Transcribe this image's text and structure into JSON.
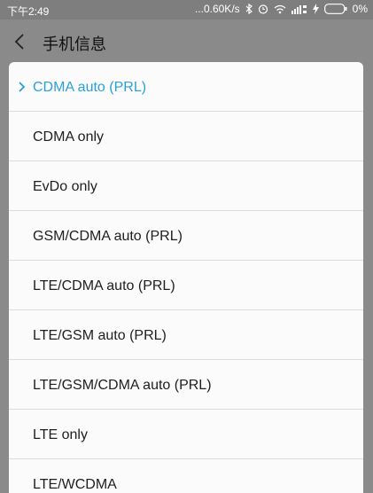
{
  "status_bar": {
    "time": "下午2:49",
    "network_speed": "...0.60K/s",
    "battery_percent": "0%",
    "icons": [
      "bluetooth-icon",
      "alarm-icon",
      "wifi-icon",
      "signal-icon",
      "charging-icon",
      "battery-icon"
    ]
  },
  "app_bar": {
    "title": "手机信息",
    "back_icon": "back-chevron-icon"
  },
  "network_options": {
    "selected": "CDMA auto (PRL)",
    "items": [
      {
        "label": "CDMA auto (PRL)"
      },
      {
        "label": "CDMA only"
      },
      {
        "label": "EvDo only"
      },
      {
        "label": "GSM/CDMA auto (PRL)"
      },
      {
        "label": "LTE/CDMA auto (PRL)"
      },
      {
        "label": "LTE/GSM auto (PRL)"
      },
      {
        "label": "LTE/GSM/CDMA auto (PRL)"
      },
      {
        "label": "LTE only"
      },
      {
        "label": "LTE/WCDMA"
      }
    ]
  },
  "colors": {
    "accent": "#2aa1d6",
    "dim_overlay": "#8a8a8a",
    "dialog_bg": "#fbfbfb"
  }
}
